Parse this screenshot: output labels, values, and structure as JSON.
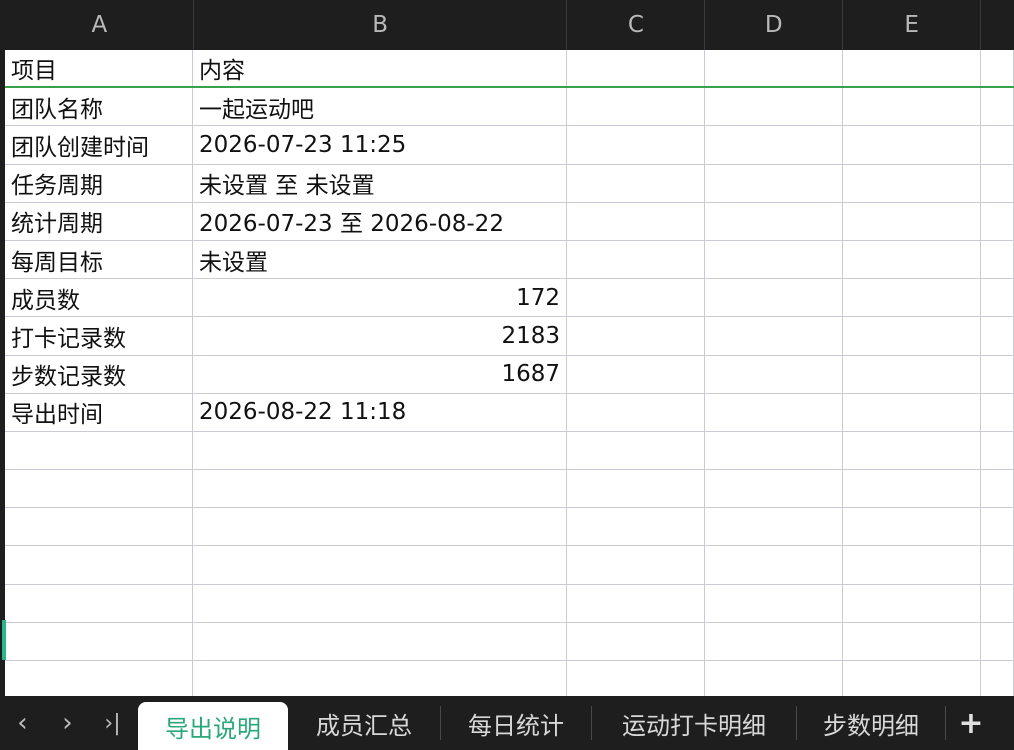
{
  "columns": [
    "A",
    "B",
    "C",
    "D",
    "E"
  ],
  "rows": [
    [
      "项目",
      "内容"
    ],
    [
      "团队名称",
      "一起运动吧"
    ],
    [
      "团队创建时间",
      "2026-07-23 11:25"
    ],
    [
      "任务周期",
      "未设置 至 未设置"
    ],
    [
      "统计周期",
      "2026-07-23 至 2026-08-22"
    ],
    [
      "每周目标",
      "未设置"
    ],
    [
      "成员数",
      "172"
    ],
    [
      "打卡记录数",
      "2183"
    ],
    [
      "步数记录数",
      "1687"
    ],
    [
      "导出时间",
      "2026-08-22 11:18"
    ]
  ],
  "sheet_tabs": [
    "导出说明",
    "成员汇总",
    "每日统计",
    "运动打卡明细",
    "步数明细"
  ],
  "active_tab_index": 0,
  "nav": {
    "prev": "‹",
    "next": "›",
    "last": "›|",
    "add": "+"
  },
  "colors": {
    "active_tab_text": "#2aa87a",
    "header_border": "#3aa14b"
  }
}
